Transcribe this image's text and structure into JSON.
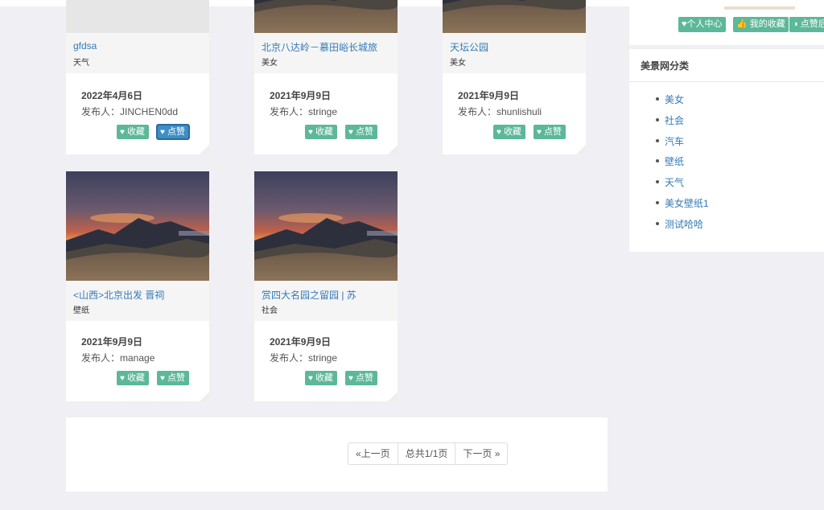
{
  "cards": [
    {
      "title": "gfdsa",
      "category": "天气",
      "date": "2022年4月6日",
      "publisher": "发布人：JINCHEN0dd",
      "collect": "收藏",
      "like": "点赞",
      "thumb": "bw"
    },
    {
      "title": "北京八达岭－慕田峪长城旅",
      "category": "美女",
      "date": "2021年9月9日",
      "publisher": "发布人：stringe",
      "collect": "收藏",
      "like": "点赞",
      "thumb": "landscape"
    },
    {
      "title": "天坛公园",
      "category": "美女",
      "date": "2021年9月9日",
      "publisher": "发布人：shunlishuli",
      "collect": "收藏",
      "like": "点赞",
      "thumb": "landscape"
    },
    {
      "title": "<山西>北京出发 晋祠",
      "category": "壁纸",
      "date": "2021年9月9日",
      "publisher": "发布人：manage",
      "collect": "收藏",
      "like": "点赞",
      "thumb": "landscape"
    },
    {
      "title": "赏四大名园之留园 | 苏",
      "category": "社会",
      "date": "2021年9月9日",
      "publisher": "发布人：stringe",
      "collect": "收藏",
      "like": "点赞",
      "thumb": "landscape"
    }
  ],
  "pagination": {
    "prev": "«上一页",
    "total": "总共1/1页",
    "next": "下一页 »"
  },
  "user_buttons": {
    "profile": "个人中心",
    "favorites": "我的收藏",
    "likes": "点赞后"
  },
  "category_panel": {
    "title": "美景网分类",
    "items": [
      "美女",
      "社会",
      "汽车",
      "壁纸",
      "天气",
      "美女壁纸1",
      "测试哈哈"
    ]
  },
  "colors": {
    "accent": "#5cb898",
    "link": "#337ab7",
    "background": "#f0f0f4"
  }
}
